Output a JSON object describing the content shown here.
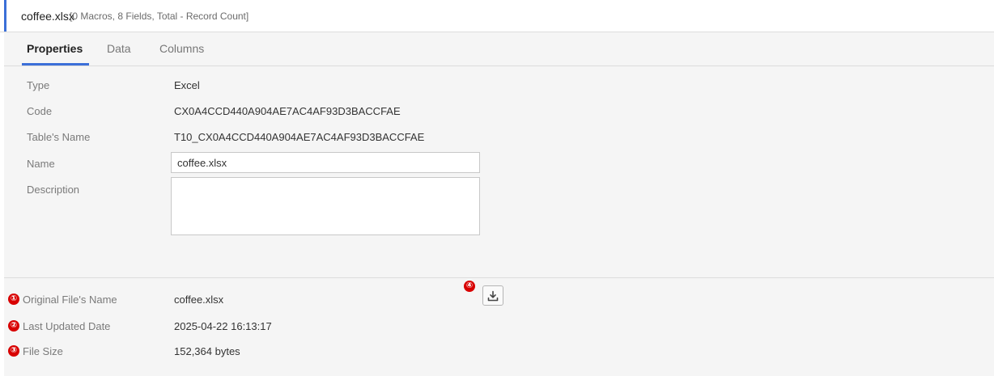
{
  "header": {
    "title": "coffee.xlsx",
    "summary": "[0 Macros, 8 Fields, Total - Record Count]"
  },
  "tabs": [
    {
      "label": "Properties",
      "active": true
    },
    {
      "label": "Data",
      "active": false
    },
    {
      "label": "Columns",
      "active": false
    }
  ],
  "properties": {
    "type_label": "Type",
    "type_value": "Excel",
    "code_label": "Code",
    "code_value": "CX0A4CCD440A904AE7AC4AF93D3BACCFAE",
    "table_name_label": "Table's Name",
    "table_name_value": "T10_CX0A4CCD440A904AE7AC4AF93D3BACCFAE",
    "name_label": "Name",
    "name_value": "coffee.xlsx",
    "description_label": "Description",
    "description_value": ""
  },
  "file_info": {
    "original_name_label": "Original File's Name",
    "original_name_value": "coffee.xlsx",
    "last_updated_label": "Last Updated Date",
    "last_updated_value": "2025-04-22 16:13:17",
    "file_size_label": "File Size",
    "file_size_value": "152,364 bytes"
  },
  "markers": [
    "①",
    "②",
    "③",
    "④"
  ],
  "colors": {
    "accent": "#3b6fd8",
    "marker": "#d80000",
    "panel_bg": "#f5f5f5"
  },
  "icons": {
    "download": "download-icon"
  }
}
